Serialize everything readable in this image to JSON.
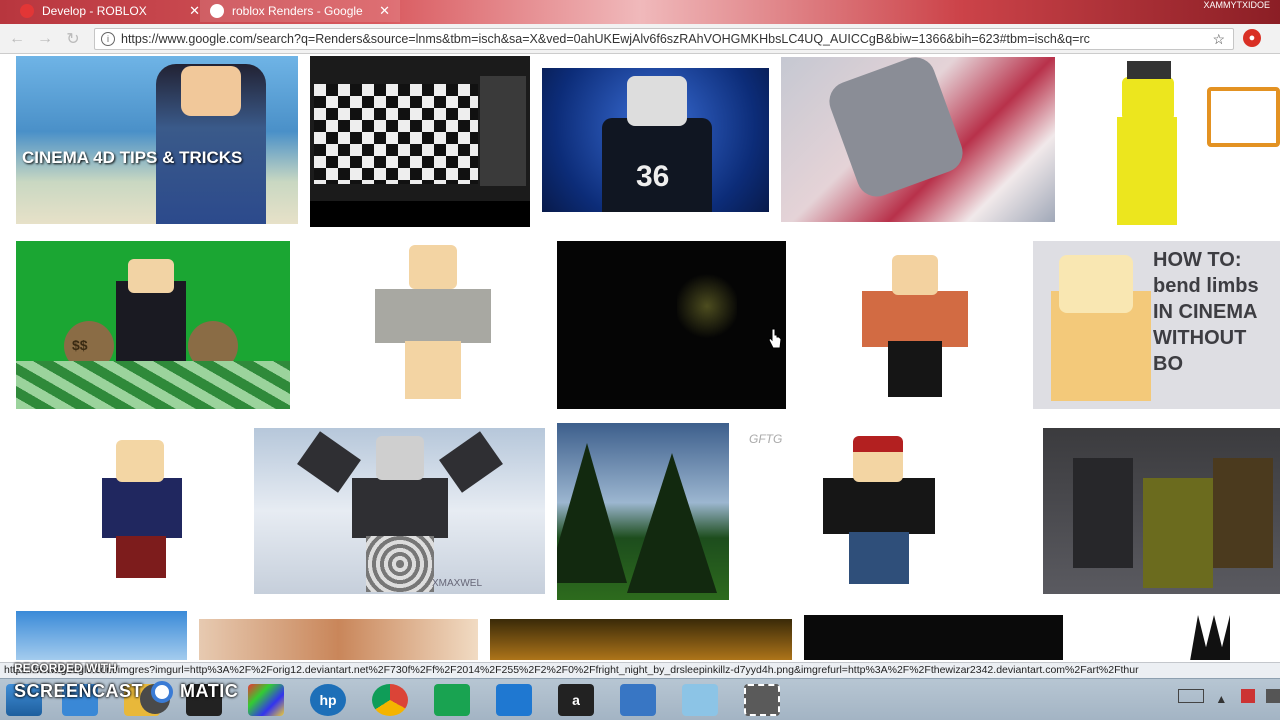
{
  "tabs": [
    {
      "title": "Develop - ROBLOX",
      "close": "✕",
      "active": false
    },
    {
      "title": "roblox Renders - Google",
      "close": "✕",
      "active": true
    }
  ],
  "profile_name": "XAMMYTXIDOE",
  "address_bar": {
    "url": "https://www.google.com/search?q=Renders&source=lnms&tbm=isch&sa=X&ved=0ahUKEwjAlv6f6szRAhVOHGMKHbsLC4UQ_AUICCgB&biw=1366&bih=623#tbm=isch&q=rc",
    "star": "☆"
  },
  "image_results": [
    {
      "overlay": "CINEMA 4D TIPS & TRICKS"
    },
    {
      "overlay": ""
    },
    {
      "overlay": "36"
    },
    {
      "overlay": ""
    },
    {
      "overlay": ""
    },
    {
      "overlay": "$$"
    },
    {
      "overlay": ""
    },
    {
      "overlay": ""
    },
    {
      "overlay": ""
    },
    {
      "overlay": "HOW TO: bend limbs IN CINEMA WITHOUT BO"
    },
    {
      "overlay": ""
    },
    {
      "overlay": "XMAXWEL"
    },
    {
      "overlay": ""
    },
    {
      "overlay": "GFTG"
    },
    {
      "overlay": ""
    },
    {
      "overlay": ""
    }
  ],
  "status_bar": {
    "text": "https://www.google.com/imgres?imgurl=http%3A%2F%2Forig12.deviantart.net%2F730f%2Ff%2F2014%2F255%2F2%2F0%2Ffright_night_by_drsleepinkillz-d7yyd4h.png&imgrefurl=http%3A%2F%2Fthewizar2342.deviantart.com%2Fart%2Fthur"
  },
  "watermark": {
    "line1": "RECORDED WITH",
    "line2": "SCREENCAST",
    "line3": "MATIC"
  },
  "taskbar": {
    "items": [
      "start",
      "ie",
      "file-explorer",
      "screencast",
      "colors",
      "hp",
      "chrome",
      "store",
      "onedrive",
      "amazon",
      "paint",
      "notepad",
      "snipping"
    ],
    "amazon_label": "a"
  },
  "colors": {
    "tab_bg": "#c9454b",
    "taskbar": "#aebdcb"
  }
}
